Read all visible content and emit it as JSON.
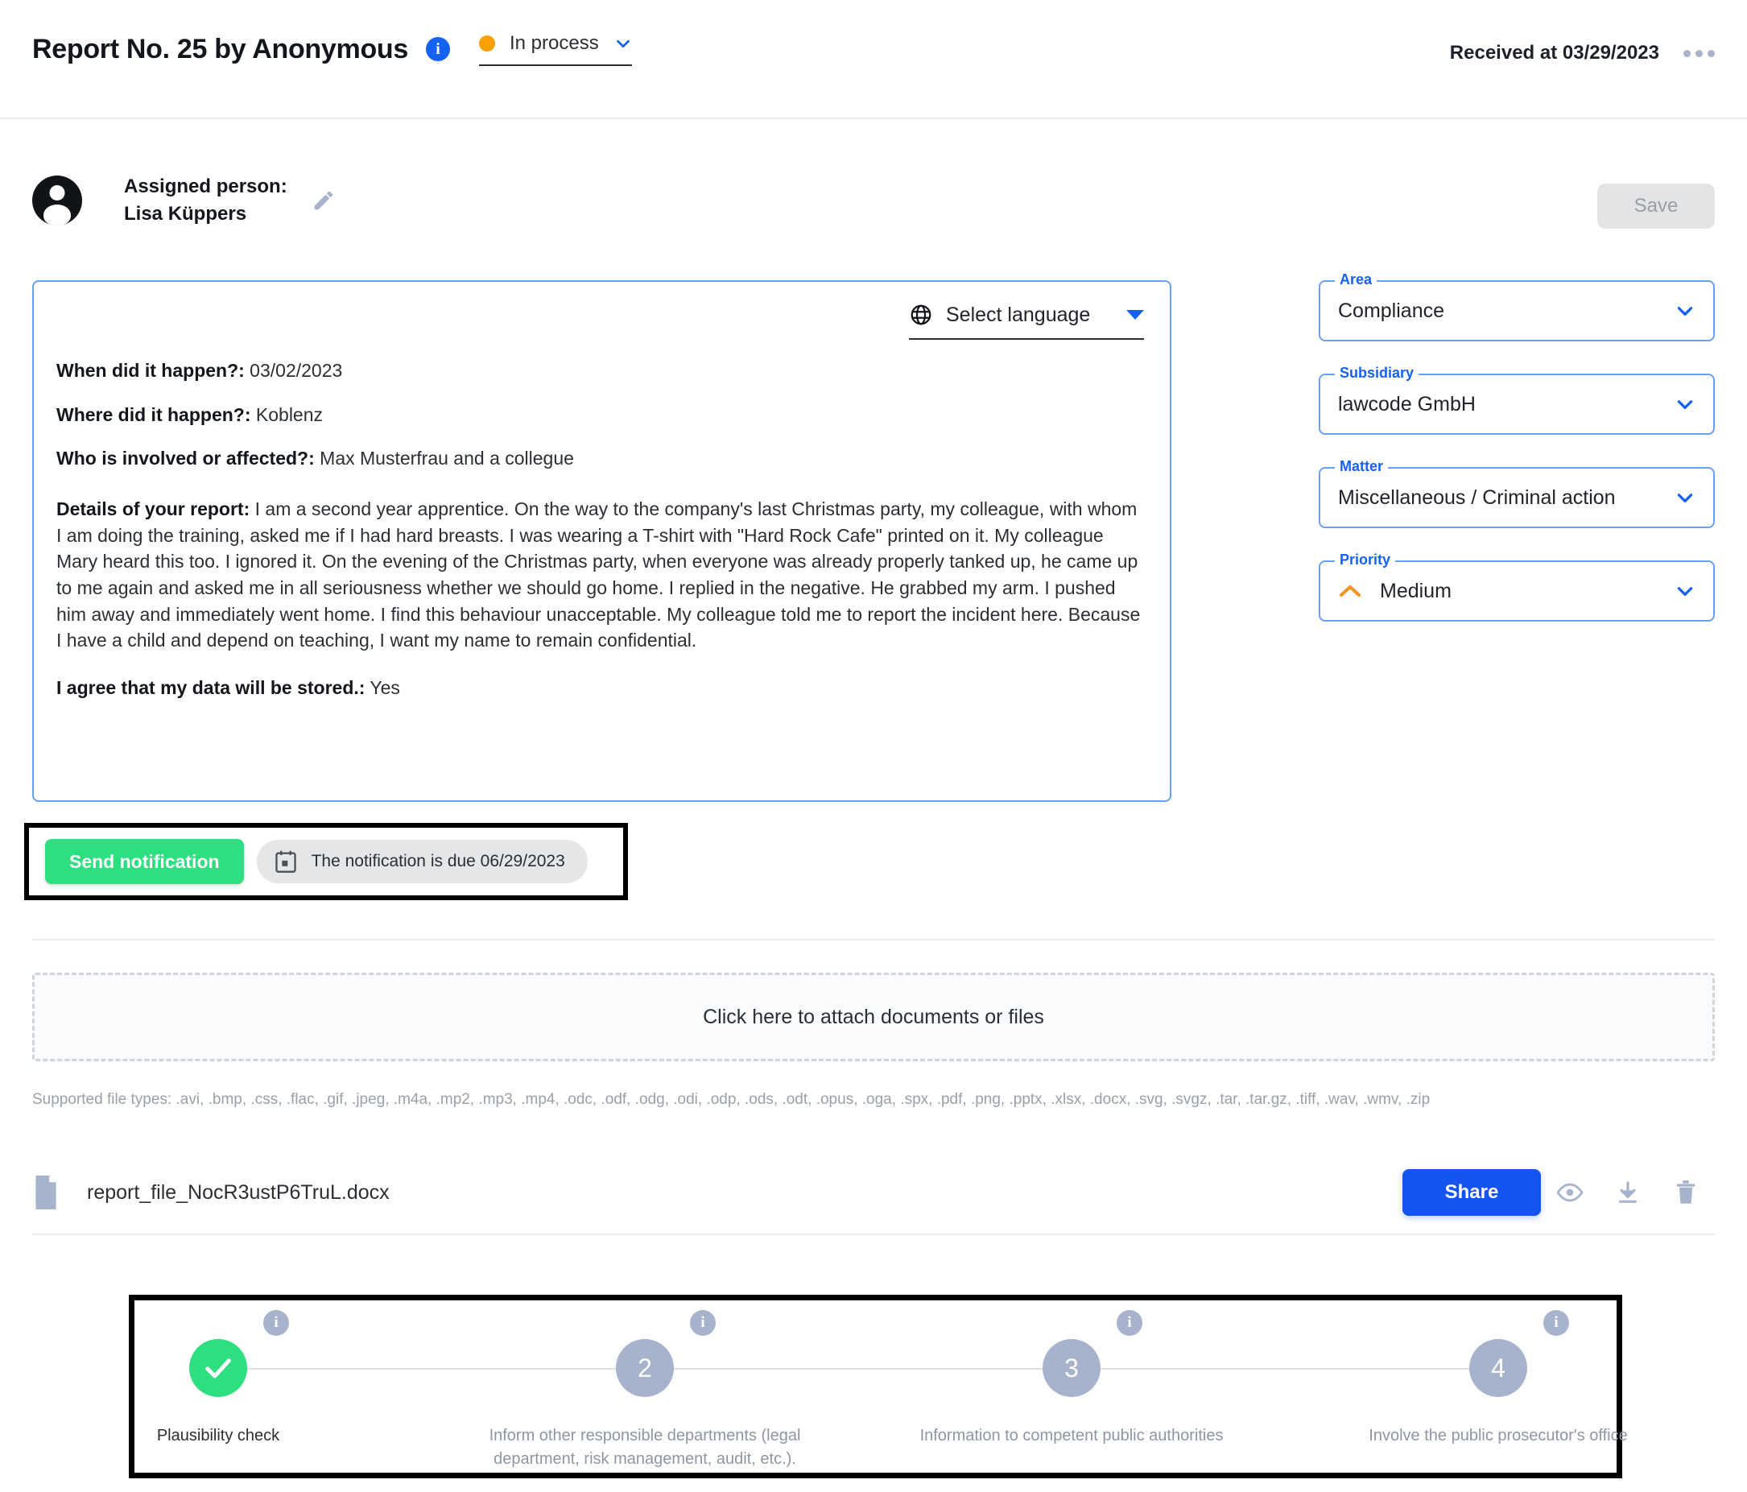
{
  "header": {
    "title": "Report No. 25 by Anonymous",
    "info_icon": "info-icon",
    "status": "In process",
    "received": "Received at 03/29/2023"
  },
  "assigned": {
    "label": "Assigned person:",
    "name": "Lisa Küppers",
    "save_label": "Save"
  },
  "report": {
    "language_placeholder": "Select language",
    "items": [
      {
        "question": "When did it happen?:",
        "answer": " 03/02/2023"
      },
      {
        "question": "Where did it happen?:",
        "answer": " Koblenz"
      },
      {
        "question": "Who is involved or affected?:",
        "answer": " Max Musterfrau and a collegue"
      }
    ],
    "details_label": "Details of your report:",
    "details_text": " I am a second year apprentice. On the way to the company's last Christmas party, my colleague, with whom I am doing the training, asked me if I had hard breasts. I was wearing a T-shirt with \"Hard Rock Cafe\" printed on it. My colleague Mary heard this too. I ignored it. On the evening of the Christmas party, when everyone was already properly tanked up, he came up to me again and asked me in all seriousness whether we should go home. I replied in the negative. He grabbed my arm. I pushed him away and immediately went home. I find this behaviour unacceptable. My colleague told me to report the incident here. Because I have a child and depend on teaching, I want my name to remain confidential.",
    "agree_label": "I agree that my data will be stored.:",
    "agree_value": " Yes"
  },
  "notification": {
    "send_label": "Send notification",
    "due_text": "The notification is due 06/29/2023"
  },
  "attachments": {
    "dropzone_label": "Click here to attach documents or files",
    "supported_types": "Supported file types: .avi, .bmp, .css, .flac, .gif, .jpeg, .m4a, .mp2, .mp3, .mp4, .odc, .odf, .odg, .odi, .odp, .ods, .odt, .opus, .oga, .spx, .pdf, .png, .pptx, .xlsx, .docx, .svg, .svgz, .tar, .tar.gz, .tiff, .wav, .wmv, .zip",
    "file_name": "report_file_NocR3ustP6TruL.docx",
    "share_label": "Share"
  },
  "side_fields": [
    {
      "legend": "Area",
      "value": "Compliance"
    },
    {
      "legend": "Subsidiary",
      "value": "lawcode GmbH"
    },
    {
      "legend": "Matter",
      "value": "Miscellaneous / Criminal action"
    },
    {
      "legend": "Priority",
      "value": "Medium"
    }
  ],
  "stepper": {
    "steps": [
      {
        "number": "",
        "label": "Plausibility check",
        "state": "done"
      },
      {
        "number": "2",
        "label": "Inform other responsible departments (legal department, risk management, audit, etc.).",
        "state": "pending"
      },
      {
        "number": "3",
        "label": "Information to competent public authorities",
        "state": "pending"
      },
      {
        "number": "4",
        "label": "Involve the public prosecutor's office",
        "state": "pending"
      }
    ]
  },
  "colors": {
    "primary_blue": "#1560f5",
    "status_orange": "#f9a103",
    "success_green": "#2ddf7f",
    "share_blue": "#1554f0",
    "step_gray": "#a7b3cd"
  }
}
